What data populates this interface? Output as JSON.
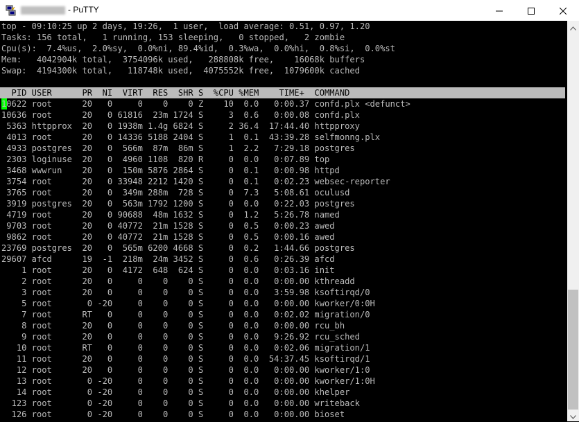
{
  "window": {
    "title": "- PuTTY",
    "icons": {
      "app": "putty-icon",
      "minimize": "minimize-icon",
      "maximize": "maximize-icon",
      "close": "close-icon"
    }
  },
  "top": {
    "summary": [
      "top - 09:10:25 up 2 days, 19:26,  1 user,  load average: 0.51, 0.97, 1.20",
      "Tasks: 156 total,   1 running, 153 sleeping,   0 stopped,   2 zombie",
      "Cpu(s):  7.4%us,  2.0%sy,  0.0%ni, 89.4%id,  0.3%wa,  0.0%hi,  0.8%si,  0.0%st",
      "Mem:   4042904k total,  3754096k used,   288808k free,    16068k buffers",
      "Swap:  4194300k total,   118748k used,  4075552k free,  1079600k cached"
    ],
    "header": "  PID USER      PR  NI  VIRT  RES  SHR S  %CPU %MEM    TIME+  COMMAND",
    "processes": [
      "10622 root      20   0     0    0    0 Z    10  0.0   0:00.37 confd.plx <defunct>",
      "10636 root      20   0 61816  23m 1724 S     3  0.6   0:00.08 confd.plx",
      " 5363 httpprox  20   0 1938m 1.4g 6824 S     2 36.4  17:44.40 httpproxy",
      " 4013 root      20   0 14336 5188 2404 S     1  0.1  43:39.28 selfmonng.plx",
      " 4933 postgres  20   0  566m  87m  86m S     1  2.2   7:29.18 postgres",
      " 2303 loginuse  20   0  4960 1108  820 R     0  0.0   0:07.89 top",
      " 3468 wwwrun    20   0  150m 5876 2864 S     0  0.1   0:00.98 httpd",
      " 3754 root      20   0 33948 2212 1420 S     0  0.1   0:02.23 websec-reporter",
      " 3765 root      20   0  349m 288m  728 S     0  7.3   5:08.61 oculusd",
      " 3919 postgres  20   0  563m 1792 1200 S     0  0.0   0:22.03 postgres",
      " 4719 root      20   0 90688  48m 1632 S     0  1.2   5:26.78 named",
      " 9703 root      20   0 40772  21m 1528 S     0  0.5   0:00.23 awed",
      " 9862 root      20   0 40772  21m 1528 S     0  0.5   0:00.16 awed",
      "23769 postgres  20   0  565m 6200 4668 S     0  0.2   1:44.66 postgres",
      "29607 afcd      19  -1  218m  24m 3452 S     0  0.6   0:26.39 afcd",
      "    1 root      20   0  4172  648  624 S     0  0.0   0:03.16 init",
      "    2 root      20   0     0    0    0 S     0  0.0   0:00.00 kthreadd",
      "    3 root      20   0     0    0    0 S     0  0.0   3:59.98 ksoftirqd/0",
      "    5 root       0 -20     0    0    0 S     0  0.0   0:00.00 kworker/0:0H",
      "    7 root      RT   0     0    0    0 S     0  0.0   0:02.02 migration/0",
      "    8 root      20   0     0    0    0 S     0  0.0   0:00.00 rcu_bh",
      "    9 root      20   0     0    0    0 S     0  0.0   9:26.92 rcu_sched",
      "   10 root      RT   0     0    0    0 S     0  0.0   0:02.06 migration/1",
      "   11 root      20   0     0    0    0 S     0  0.0  54:37.45 ksoftirqd/1",
      "   12 root      20   0     0    0    0 S     0  0.0   0:00.00 kworker/1:0",
      "   13 root       0 -20     0    0    0 S     0  0.0   0:00.00 kworker/1:0H",
      "   14 root       0 -20     0    0    0 S     0  0.0   0:00.00 khelper",
      "  123 root       0 -20     0    0    0 S     0  0.0   0:00.00 writeback",
      "  126 root       0 -20     0    0    0 S     0  0.0   0:00.00 bioset"
    ]
  },
  "colors": {
    "text": "#bbbbbb",
    "background": "#000000",
    "cursor": "#00ff00",
    "header_bg": "#bbbbbb"
  }
}
